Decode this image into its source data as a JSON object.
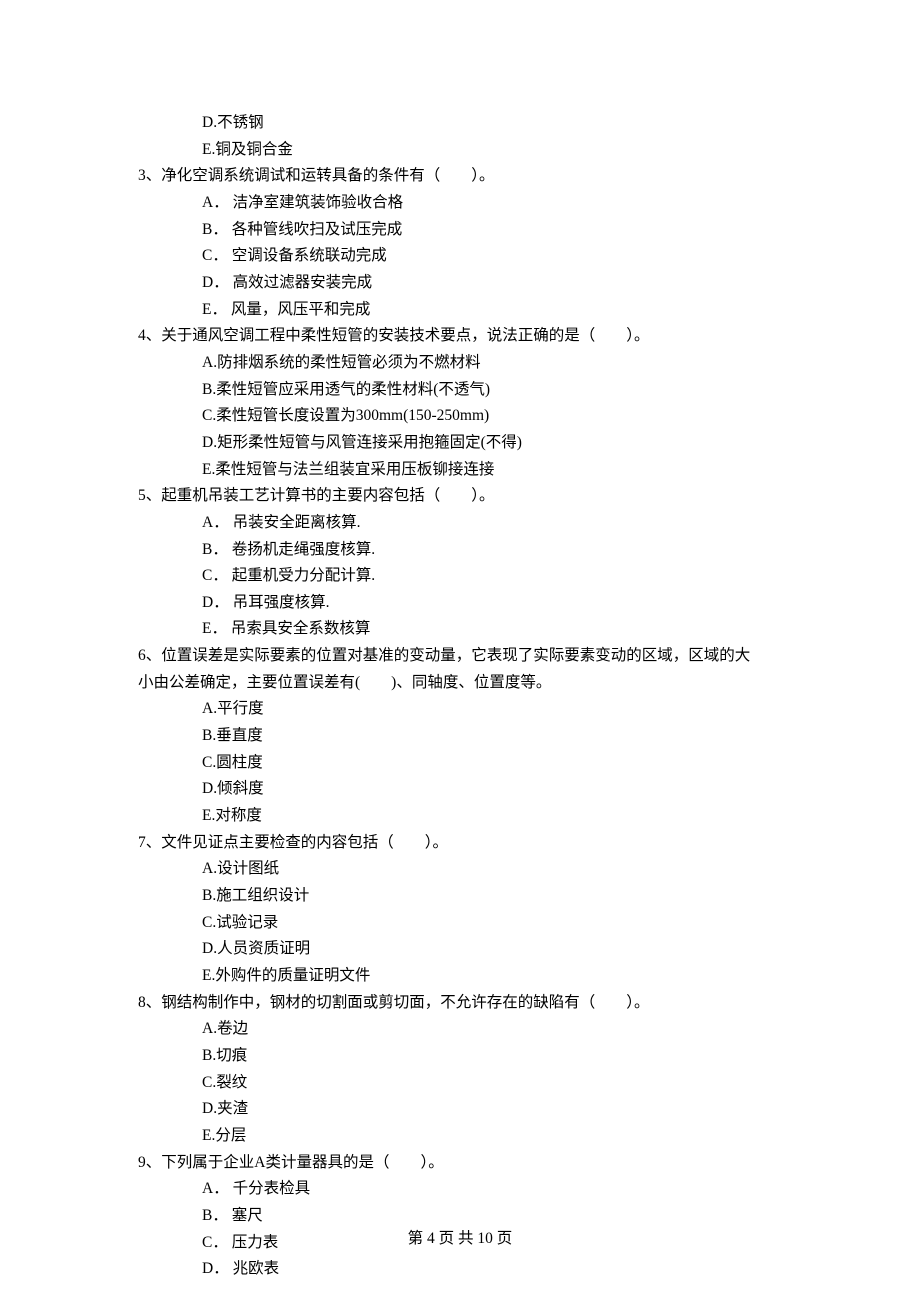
{
  "orphan_options": {
    "D": "不锈钢",
    "E": "铜及铜合金"
  },
  "questions": [
    {
      "num": "3",
      "stem": "净化空调系统调试和运转具备的条件有（　　）。",
      "opts": {
        "A": "洁净室建筑装饰验收合格",
        "B": "各种管线吹扫及试压完成",
        "C": "空调设备系统联动完成",
        "D": "高效过滤器安装完成",
        "E": "风量，风压平和完成"
      },
      "sep": "．"
    },
    {
      "num": "4",
      "stem": "关于通风空调工程中柔性短管的安装技术要点，说法正确的是（　　）。",
      "opts": {
        "A": "防排烟系统的柔性短管必须为不燃材料",
        "B": "柔性短管应采用透气的柔性材料(不透气)",
        "C": "柔性短管长度设置为300mm(150-250mm)",
        "D": "矩形柔性短管与风管连接采用抱箍固定(不得)",
        "E": "柔性短管与法兰组装宜采用压板铆接连接"
      },
      "sep": "."
    },
    {
      "num": "5",
      "stem": "起重机吊装工艺计算书的主要内容包括（　　）。",
      "opts": {
        "A": "吊装安全距离核算.",
        "B": "卷扬机走绳强度核算.",
        "C": "起重机受力分配计算.",
        "D": "吊耳强度核算.",
        "E": "吊索具安全系数核算"
      },
      "sep": "．"
    },
    {
      "num": "6",
      "stem": "位置误差是实际要素的位置对基准的变动量，它表现了实际要素变动的区域，区域的大小由公差确定，主要位置误差有(　　)、同轴度、位置度等。",
      "opts": {
        "A": "平行度",
        "B": "垂直度",
        "C": "圆柱度",
        "D": "倾斜度",
        "E": "对称度"
      },
      "sep": ".",
      "wrap": true
    },
    {
      "num": "7",
      "stem": "文件见证点主要检查的内容包括（　　）。",
      "opts": {
        "A": "设计图纸",
        "B": "施工组织设计",
        "C": "试验记录",
        "D": "人员资质证明",
        "E": "外购件的质量证明文件"
      },
      "sep": "."
    },
    {
      "num": "8",
      "stem": "钢结构制作中，钢材的切割面或剪切面，不允许存在的缺陷有（　　）。",
      "opts": {
        "A": "卷边",
        "B": "切痕",
        "C": "裂纹",
        "D": "夹渣",
        "E": "分层"
      },
      "sep": "."
    },
    {
      "num": "9",
      "stem": "下列属于企业A类计量器具的是（　　）。",
      "opts": {
        "A": "千分表检具",
        "B": "塞尺",
        "C": "压力表",
        "D": "兆欧表"
      },
      "sep": "．"
    }
  ],
  "footer": "第 4 页 共 10 页"
}
